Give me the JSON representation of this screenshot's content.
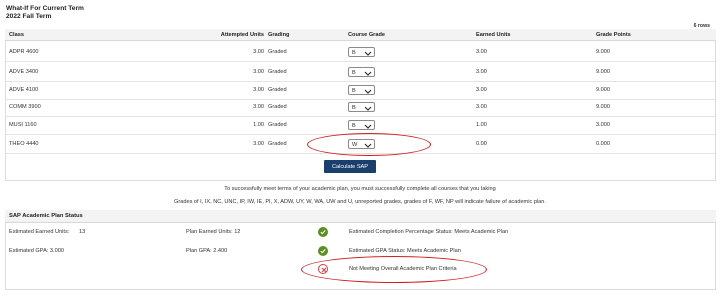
{
  "header": {
    "title_line1": "What-If For Current Term",
    "title_line2": "2022 Fall Term",
    "rows_count": "6 rows"
  },
  "table": {
    "columns": [
      "Class",
      "Attempted Units",
      "Grading",
      "Course Grade",
      "Earned Units",
      "Grade Points"
    ],
    "rows": [
      {
        "class": "ADPR 4600",
        "units": "3.00",
        "grading": "Graded",
        "grade": "B",
        "earned": "3.00",
        "points": "9.000"
      },
      {
        "class": "ADVE 3400",
        "units": "3.00",
        "grading": "Graded",
        "grade": "B",
        "earned": "3.00",
        "points": "9.000"
      },
      {
        "class": "ADVE 4100",
        "units": "3.00",
        "grading": "Graded",
        "grade": "B",
        "earned": "3.00",
        "points": "9.000"
      },
      {
        "class": "COMM 3900",
        "units": "3.00",
        "grading": "Graded",
        "grade": "B",
        "earned": "3.00",
        "points": "9.000"
      },
      {
        "class": "MUSI 1160",
        "units": "1.00",
        "grading": "Graded",
        "grade": "B",
        "earned": "1.00",
        "points": "3.000"
      },
      {
        "class": "THEO 4440",
        "units": "3.00",
        "grading": "Graded",
        "grade": "W",
        "earned": "0.00",
        "points": "0.000"
      }
    ]
  },
  "actions": {
    "calculate_label": "Calculate SAP"
  },
  "notes": {
    "line1": "To successfully meet terms of your academic plan, you must successfully complete all courses that you taking",
    "line2": "Grades of I, IX, NC, UNC, IP, IW, IE, PI, X, ADW, UY, W, WA, UW and U, unreported grades, grades of F, WF, NP will indicate failure of academic plan."
  },
  "status": {
    "title": "SAP Academic Plan Status",
    "est_earned_label": "Estimated Earned Units:",
    "est_earned_value": "13",
    "plan_earned": "Plan Earned Units: 12",
    "completion_status": "Estimated Completion Percentage Status: Meets Academic Plan",
    "est_gpa": "Estimated GPA:  3.000",
    "plan_gpa": "Plan GPA: 2.400",
    "gpa_status": "Estimated GPA Status: Meets Academic Plan",
    "overall_status": "Not Meeting Overall Academic Plan Criteria"
  },
  "colors": {
    "button_bg": "#1b3f6c",
    "ok_icon": "#5a8f22",
    "error_icon": "#d13c3c",
    "annotation_ring": "#d11f1f"
  },
  "icons": {
    "ok": "check-circle-icon",
    "error": "x-circle-icon",
    "dropdown": "chevron-down-icon"
  }
}
